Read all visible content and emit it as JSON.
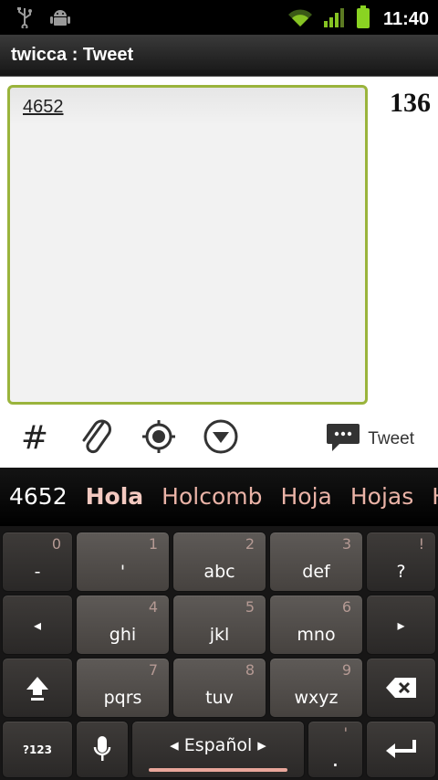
{
  "status_bar": {
    "time": "11:40",
    "left_icons": [
      "usb-icon",
      "android-debug-icon"
    ],
    "right_icons": [
      "wifi-icon",
      "signal-icon",
      "battery-icon"
    ]
  },
  "title_bar": {
    "title": "twicca : Tweet"
  },
  "compose": {
    "text": "4652",
    "char_count": "136"
  },
  "toolbar": {
    "hashtag_label": "#",
    "tweet_label": "Tweet",
    "icons": [
      "hashtag-icon",
      "attach-icon",
      "location-icon",
      "more-icon",
      "tweet-icon"
    ]
  },
  "suggestions": [
    "4652",
    "Hola",
    "Holcomb",
    "Hoja",
    "Hojas",
    "H"
  ],
  "keyboard": {
    "row1": [
      {
        "main": "-",
        "sub": "0"
      },
      {
        "main": "'",
        "sub": "1"
      },
      {
        "main": "abc",
        "sub": "2"
      },
      {
        "main": "def",
        "sub": "3"
      },
      {
        "main": "?",
        "sub": "!"
      }
    ],
    "row2": [
      {
        "main": "◂",
        "sub": ""
      },
      {
        "main": "ghi",
        "sub": "4"
      },
      {
        "main": "jkl",
        "sub": "5"
      },
      {
        "main": "mno",
        "sub": "6"
      },
      {
        "main": "▸",
        "sub": ""
      }
    ],
    "row3": [
      {
        "main": "",
        "sub": ""
      },
      {
        "main": "pqrs",
        "sub": "7"
      },
      {
        "main": "tuv",
        "sub": "8"
      },
      {
        "main": "wxyz",
        "sub": "9"
      },
      {
        "main": "",
        "sub": ""
      }
    ],
    "symbols_label": "?123",
    "space_label": "◂ Español ▸",
    "period_main": ".",
    "period_sub": "'"
  }
}
